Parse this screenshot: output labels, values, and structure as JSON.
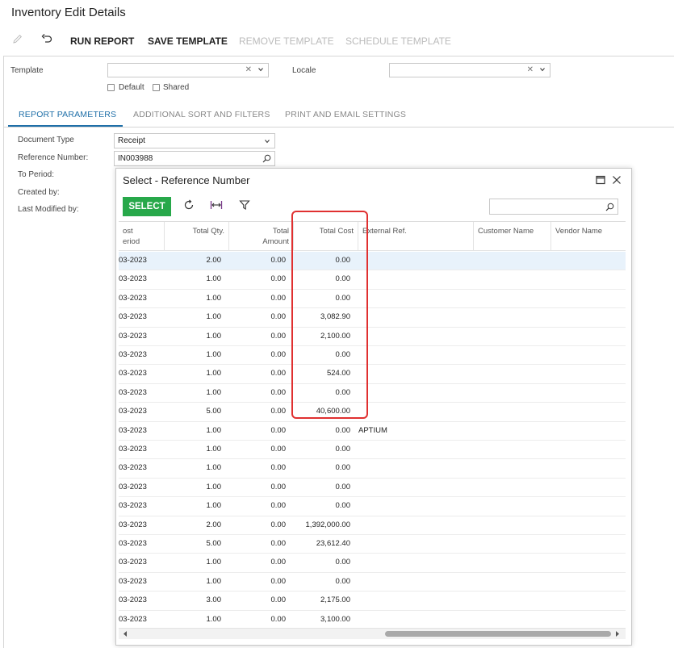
{
  "page_title": "Inventory Edit Details",
  "toolbar": {
    "edit_icon": "pencil-icon",
    "undo_icon": "undo-icon",
    "run_report": "RUN REPORT",
    "save_template": "SAVE TEMPLATE",
    "remove_template": "REMOVE TEMPLATE",
    "schedule_template": "SCHEDULE TEMPLATE"
  },
  "form": {
    "template_label": "Template",
    "template_value": "",
    "locale_label": "Locale",
    "locale_value": "",
    "default_label": "Default",
    "shared_label": "Shared"
  },
  "tabs": [
    "REPORT PARAMETERS",
    "ADDITIONAL SORT AND FILTERS",
    "PRINT AND EMAIL SETTINGS"
  ],
  "params": {
    "document_type_label": "Document Type",
    "document_type_value": "Receipt",
    "reference_number_label": "Reference Number:",
    "reference_number_value": "IN003988",
    "to_period_label": "To Period:",
    "created_by_label": "Created by:",
    "last_modified_label": "Last Modified by:"
  },
  "dialog": {
    "title": "Select - Reference Number",
    "select_button": "SELECT",
    "search_placeholder": "",
    "columns": {
      "period_line1": "ost",
      "period_line2": "eriod",
      "total_qty": "Total Qty.",
      "total_amount_line1": "Total",
      "total_amount_line2": "Amount",
      "total_cost": "Total Cost",
      "external_ref": "External Ref.",
      "customer_name": "Customer Name",
      "vendor_name": "Vendor Name"
    },
    "rows": [
      {
        "period": "03-2023",
        "qty": "2.00",
        "amount": "0.00",
        "cost": "0.00",
        "ext": ""
      },
      {
        "period": "03-2023",
        "qty": "1.00",
        "amount": "0.00",
        "cost": "0.00",
        "ext": ""
      },
      {
        "period": "03-2023",
        "qty": "1.00",
        "amount": "0.00",
        "cost": "0.00",
        "ext": ""
      },
      {
        "period": "03-2023",
        "qty": "1.00",
        "amount": "0.00",
        "cost": "3,082.90",
        "ext": ""
      },
      {
        "period": "03-2023",
        "qty": "1.00",
        "amount": "0.00",
        "cost": "2,100.00",
        "ext": ""
      },
      {
        "period": "03-2023",
        "qty": "1.00",
        "amount": "0.00",
        "cost": "0.00",
        "ext": ""
      },
      {
        "period": "03-2023",
        "qty": "1.00",
        "amount": "0.00",
        "cost": "524.00",
        "ext": ""
      },
      {
        "period": "03-2023",
        "qty": "1.00",
        "amount": "0.00",
        "cost": "0.00",
        "ext": ""
      },
      {
        "period": "03-2023",
        "qty": "5.00",
        "amount": "0.00",
        "cost": "40,600.00",
        "ext": ""
      },
      {
        "period": "03-2023",
        "qty": "1.00",
        "amount": "0.00",
        "cost": "0.00",
        "ext": "APTIUM"
      },
      {
        "period": "03-2023",
        "qty": "1.00",
        "amount": "0.00",
        "cost": "0.00",
        "ext": ""
      },
      {
        "period": "03-2023",
        "qty": "1.00",
        "amount": "0.00",
        "cost": "0.00",
        "ext": ""
      },
      {
        "period": "03-2023",
        "qty": "1.00",
        "amount": "0.00",
        "cost": "0.00",
        "ext": ""
      },
      {
        "period": "03-2023",
        "qty": "1.00",
        "amount": "0.00",
        "cost": "0.00",
        "ext": ""
      },
      {
        "period": "03-2023",
        "qty": "2.00",
        "amount": "0.00",
        "cost": "1,392,000.00",
        "ext": ""
      },
      {
        "period": "03-2023",
        "qty": "5.00",
        "amount": "0.00",
        "cost": "23,612.40",
        "ext": ""
      },
      {
        "period": "03-2023",
        "qty": "1.00",
        "amount": "0.00",
        "cost": "0.00",
        "ext": ""
      },
      {
        "period": "03-2023",
        "qty": "1.00",
        "amount": "0.00",
        "cost": "0.00",
        "ext": ""
      },
      {
        "period": "03-2023",
        "qty": "3.00",
        "amount": "0.00",
        "cost": "2,175.00",
        "ext": ""
      },
      {
        "period": "03-2023",
        "qty": "1.00",
        "amount": "0.00",
        "cost": "3,100.00",
        "ext": ""
      }
    ]
  },
  "colors": {
    "accent": "#1f6fa8",
    "select_button": "#27a84a",
    "highlight": "#e03030",
    "selected_row": "#e8f2fb"
  }
}
